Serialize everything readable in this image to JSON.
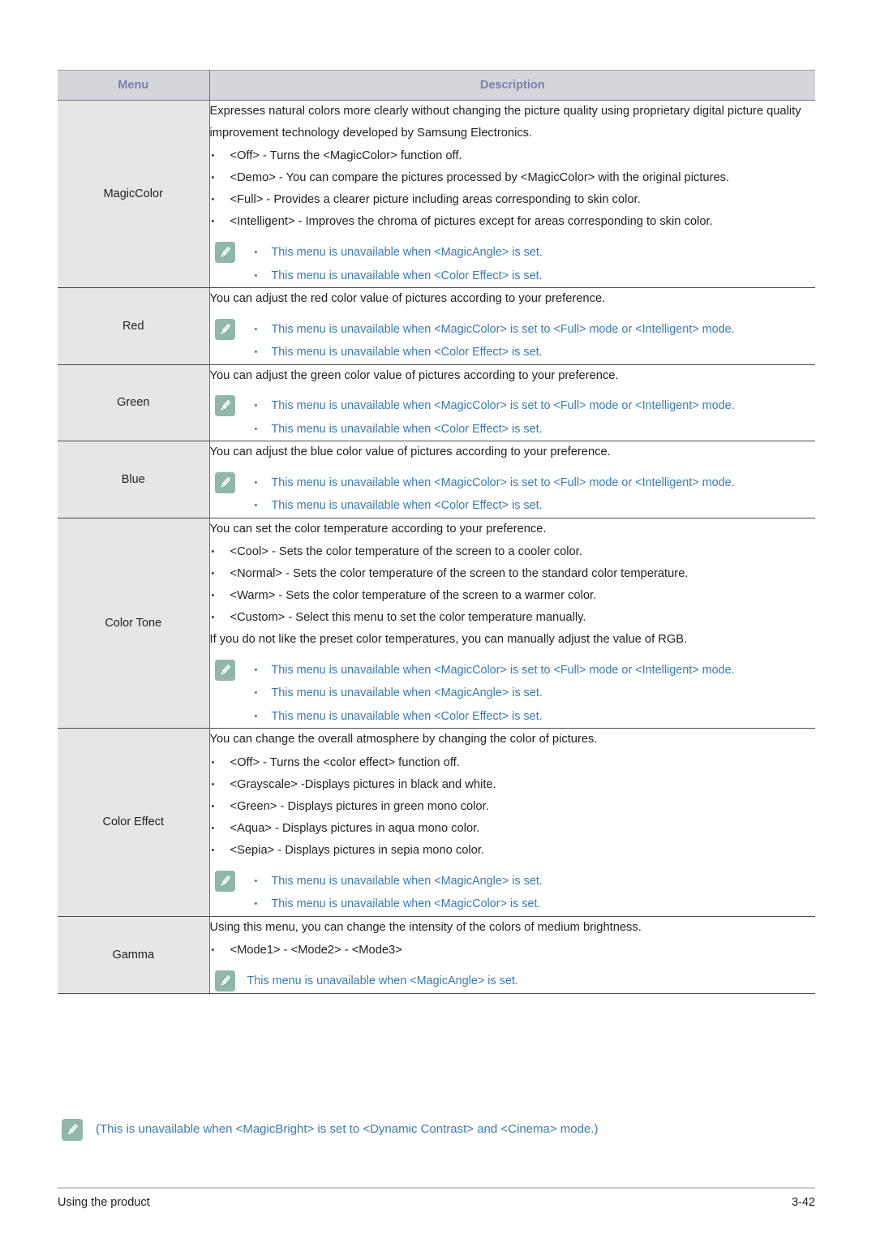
{
  "table": {
    "headers": {
      "menu": "Menu",
      "description": "Description"
    },
    "rows": [
      {
        "menu": "MagicColor",
        "lead": "Expresses natural colors more clearly without changing the picture quality using proprietary digital picture quality improvement technology developed by Samsung Electronics.",
        "options": [
          "<Off> - Turns the <MagicColor> function off.",
          "<Demo> - You can compare the pictures processed by <MagicColor> with the original pictures.",
          "<Full> - Provides a clearer picture including areas corresponding to skin color.",
          "<Intelligent> - Improves the chroma of pictures except for areas corresponding to skin color."
        ],
        "notes": [
          "This menu is unavailable when <MagicAngle> is set.",
          "This menu is unavailable when <Color Effect> is set."
        ],
        "trailing_lead": ""
      },
      {
        "menu": "Red",
        "lead": "You can adjust the red color value of pictures according to your preference.",
        "options": [],
        "notes": [
          "This menu is unavailable when <MagicColor> is set to <Full> mode or <Intelligent> mode.",
          "This menu is unavailable when <Color Effect> is set."
        ],
        "trailing_lead": ""
      },
      {
        "menu": "Green",
        "lead": "You can adjust the green color value of pictures according to your preference.",
        "options": [],
        "notes": [
          "This menu is unavailable when <MagicColor> is set to <Full> mode or <Intelligent> mode.",
          "This menu is unavailable when <Color Effect> is set."
        ],
        "trailing_lead": ""
      },
      {
        "menu": "Blue",
        "lead": "You can adjust the blue color value of pictures according to your preference.",
        "options": [],
        "notes": [
          "This menu is unavailable when <MagicColor> is set to <Full> mode or <Intelligent> mode.",
          "This menu is unavailable when <Color Effect> is set."
        ],
        "trailing_lead": ""
      },
      {
        "menu": "Color Tone",
        "lead": "You can set the color temperature according to your preference.",
        "options": [
          "<Cool> - Sets the color temperature of the screen to a cooler color.",
          "<Normal> - Sets the color temperature of the screen to the standard color temperature.",
          "<Warm> - Sets the color temperature of the screen to a warmer color.",
          "<Custom> - Select this menu to set the color temperature manually."
        ],
        "trailing_lead": "If you do not like the preset color temperatures, you can manually adjust the value of RGB.",
        "notes": [
          "This menu is unavailable when <MagicColor> is set to <Full> mode or <Intelligent> mode.",
          "This menu is unavailable when <MagicAngle> is set.",
          "This menu is unavailable when <Color Effect> is set."
        ]
      },
      {
        "menu": "Color Effect",
        "lead": "You can change the overall atmosphere by changing the color of pictures.",
        "options": [
          "<Off> - Turns the <color effect> function off.",
          "<Grayscale> -Displays pictures in black and white.",
          "<Green> - Displays pictures in green mono color.",
          "<Aqua> - Displays pictures in aqua mono color.",
          "<Sepia> - Displays pictures in sepia mono color."
        ],
        "notes": [
          "This menu is unavailable when <MagicAngle> is set.",
          "This menu is unavailable when <MagicColor> is set."
        ],
        "trailing_lead": ""
      },
      {
        "menu": "Gamma",
        "lead": "Using this menu, you can change the intensity of the colors of medium brightness.",
        "options": [
          "<Mode1> - <Mode2> - <Mode3>"
        ],
        "notes_plain": "This menu is unavailable when <MagicAngle> is set.",
        "notes": [],
        "trailing_lead": ""
      }
    ]
  },
  "footer_note": "(This is unavailable when <MagicBright> is set to <Dynamic Contrast> and <Cinema> mode.)",
  "footer": {
    "left": "Using the product",
    "right": "3-42"
  },
  "colors": {
    "header_text": "#7b7fb0",
    "header_bg": "#d4d6d9",
    "menu_bg": "#e6e6e6",
    "note_text": "#3a7ab5",
    "note_icon_bg": "#8fb8a8",
    "body_text": "#231f20"
  },
  "icons": {
    "note": "note-pencil-icon"
  }
}
